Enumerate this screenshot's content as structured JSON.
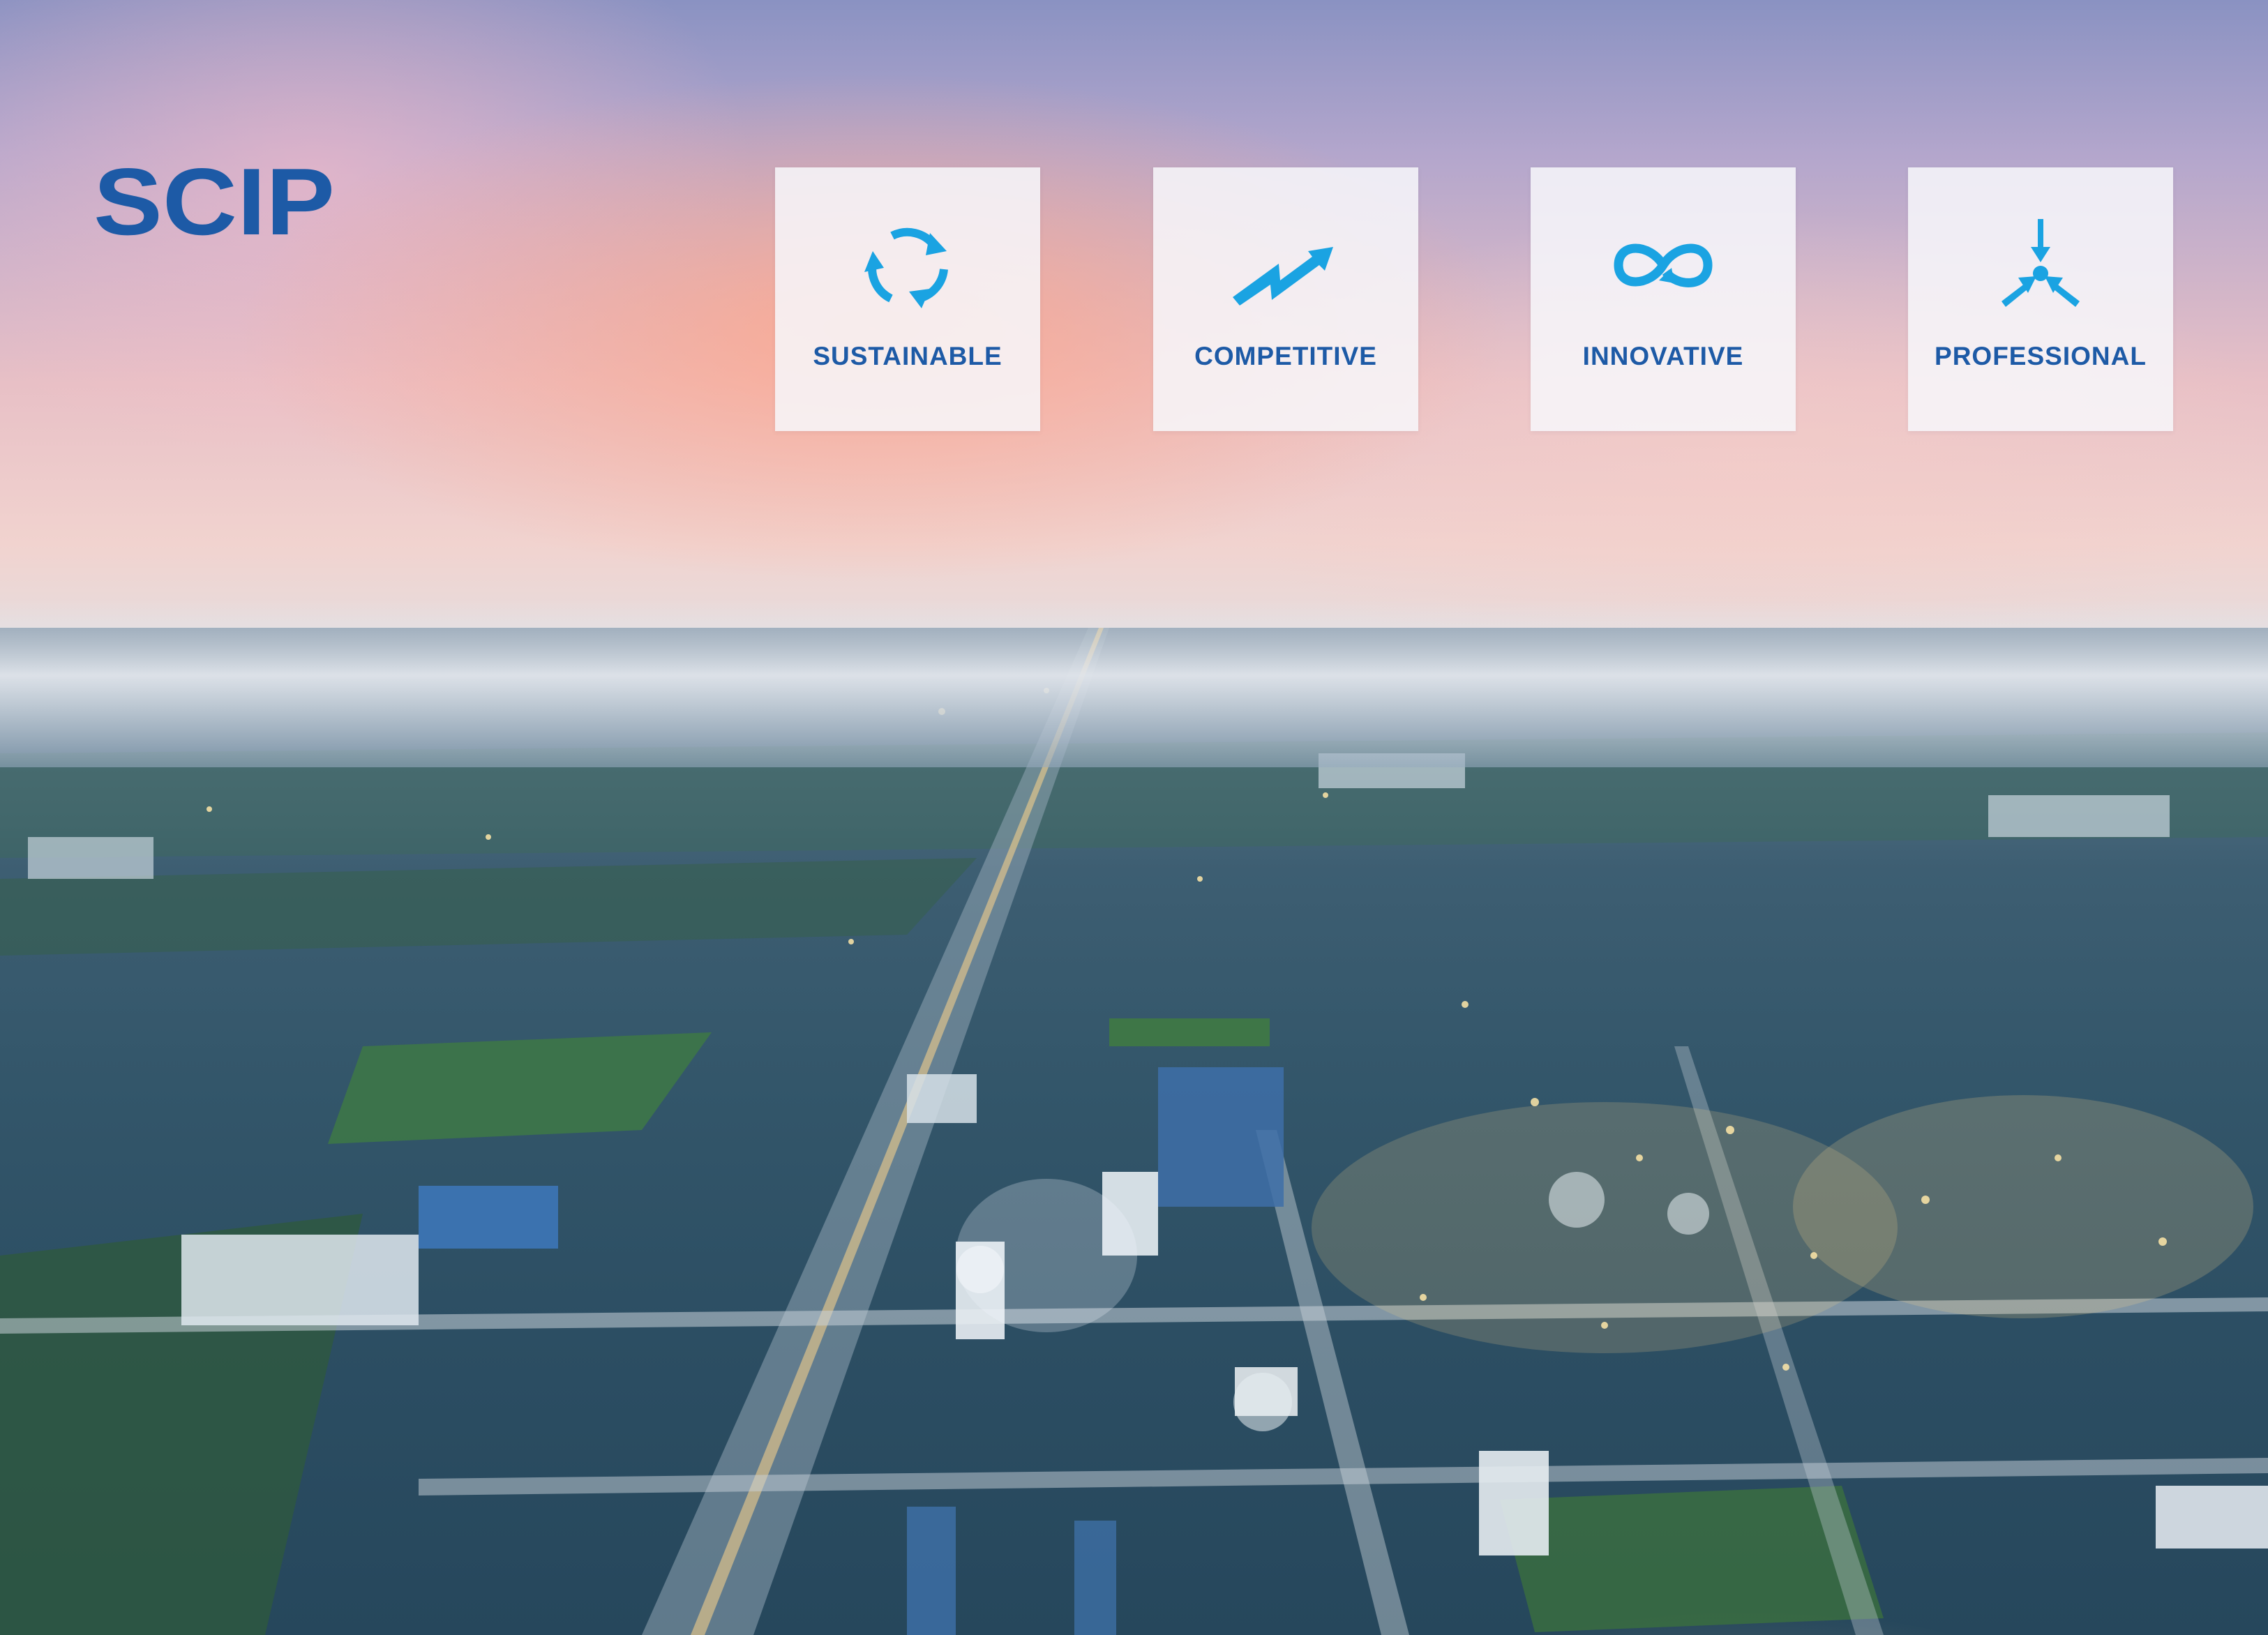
{
  "logo": {
    "text": "SCIP"
  },
  "colors": {
    "brand_blue": "#1d5aa6",
    "icon_cyan": "#1aa3e2",
    "card_bg": "#f7f7fa"
  },
  "values": [
    {
      "label": "SUSTAINABLE",
      "icon": "recycle-arrows-icon"
    },
    {
      "label": "COMPETITIVE",
      "icon": "rising-trend-arrow-icon"
    },
    {
      "label": "INNOVATIVE",
      "icon": "infinity-arrows-icon"
    },
    {
      "label": "PROFESSIONAL",
      "icon": "converging-arrows-icon"
    }
  ]
}
